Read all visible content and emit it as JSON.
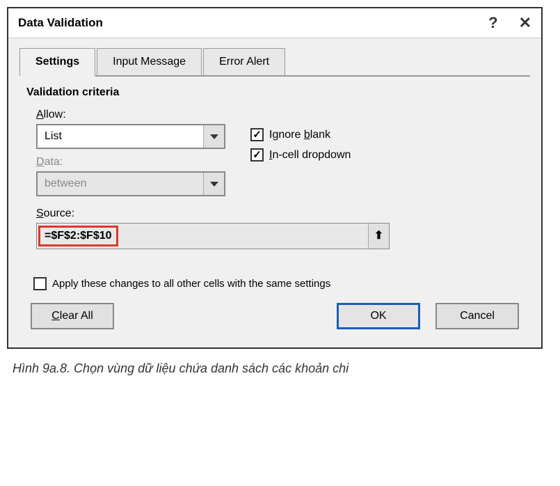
{
  "titlebar": {
    "title": "Data Validation",
    "help": "?",
    "close": "✕"
  },
  "tabs": {
    "settings": "Settings",
    "input_message": "Input Message",
    "error_alert": "Error Alert"
  },
  "section": {
    "criteria_title": "Validation criteria",
    "allow_label_pre": "",
    "allow_label_u": "A",
    "allow_label_post": "llow:",
    "allow_value": "List",
    "data_label_pre": "",
    "data_label_u": "D",
    "data_label_post": "ata:",
    "data_value": "between",
    "source_label_pre": "",
    "source_label_u": "S",
    "source_label_post": "ource:",
    "source_value": "=$F$2:$F$10"
  },
  "checkboxes": {
    "ignore_blank_pre": "Ignore ",
    "ignore_blank_u": "b",
    "ignore_blank_post": "lank",
    "incell_pre": "",
    "incell_u": "I",
    "incell_post": "n-cell dropdown",
    "apply_pre": "Apply these changes to all other cells with the same settings"
  },
  "buttons": {
    "clear_all_u": "C",
    "clear_all_post": "lear All",
    "ok": "OK",
    "cancel": "Cancel"
  },
  "caption": "Hình 9a.8. Chọn vùng dữ liệu chứa danh sách các khoản chi"
}
